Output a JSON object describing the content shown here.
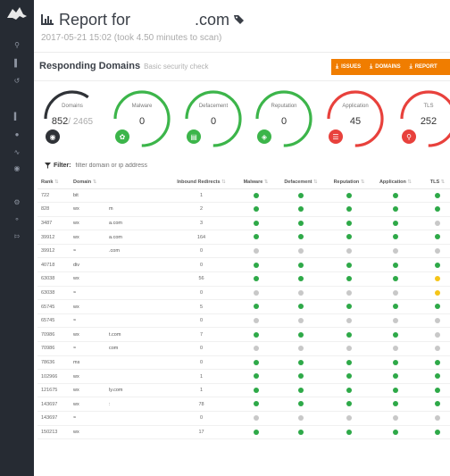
{
  "header": {
    "title_prefix": "Report for",
    "title_domain": ".com",
    "scan_info": "2017-05-21 15:02 (took 4.50 minutes to scan)"
  },
  "section": {
    "title": "Responding Domains",
    "subtitle": "Basic security check"
  },
  "buttons": {
    "issues": "ISSUES",
    "domains": "DOMAINS",
    "report": "REPORT"
  },
  "gauges": [
    {
      "label": "Domains",
      "value": "852",
      "total": "/ 2465",
      "color": "#2f3237",
      "icon": "globe-icon",
      "fraction": 0.35
    },
    {
      "label": "Malware",
      "value": "0",
      "total": "",
      "color": "#3cb54a",
      "icon": "bug-icon",
      "fraction": 0.75
    },
    {
      "label": "Defacement",
      "value": "0",
      "total": "",
      "color": "#3cb54a",
      "icon": "file-icon",
      "fraction": 0.75
    },
    {
      "label": "Reputation",
      "value": "0",
      "total": "",
      "color": "#3cb54a",
      "icon": "tag-icon",
      "fraction": 0.75
    },
    {
      "label": "Application",
      "value": "45",
      "total": "",
      "color": "#e8413c",
      "icon": "database-icon",
      "fraction": 0.75
    },
    {
      "label": "TLS",
      "value": "252",
      "total": "",
      "color": "#e8413c",
      "icon": "key-icon",
      "fraction": 0.75
    }
  ],
  "filter": {
    "label": "Filter:",
    "placeholder": "filter domain or ip address"
  },
  "table": {
    "columns": [
      "Rank",
      "Domain",
      "Inbound Redirects",
      "Malware",
      "Defacement",
      "Reputation",
      "Application",
      "TLS"
    ],
    "rows": [
      {
        "rank": "722",
        "prefix": "bit",
        "domain_tail": "",
        "redirects": "1",
        "status": [
          "g",
          "g",
          "g",
          "g",
          "g"
        ]
      },
      {
        "rank": "828",
        "prefix": "wx",
        "domain_tail": "m",
        "redirects": "2",
        "status": [
          "g",
          "g",
          "g",
          "g",
          "g"
        ]
      },
      {
        "rank": "3487",
        "prefix": "wx",
        "domain_tail": "a.com",
        "redirects": "3",
        "status": [
          "g",
          "g",
          "g",
          "g",
          "s"
        ]
      },
      {
        "rank": "39912",
        "prefix": "wx",
        "domain_tail": "a.com",
        "redirects": "164",
        "status": [
          "g",
          "g",
          "g",
          "g",
          "g"
        ]
      },
      {
        "rank": "39912",
        "prefix": "≈",
        "domain_tail": ".com",
        "redirects": "0",
        "status": [
          "s",
          "s",
          "s",
          "s",
          "s"
        ]
      },
      {
        "rank": "40718",
        "prefix": "div",
        "domain_tail": "",
        "redirects": "0",
        "status": [
          "g",
          "g",
          "g",
          "g",
          "g"
        ]
      },
      {
        "rank": "63038",
        "prefix": "wx",
        "domain_tail": "",
        "redirects": "56",
        "status": [
          "g",
          "g",
          "g",
          "g",
          "y"
        ]
      },
      {
        "rank": "63038",
        "prefix": "≈",
        "domain_tail": "",
        "redirects": "0",
        "status": [
          "s",
          "s",
          "s",
          "s",
          "y"
        ]
      },
      {
        "rank": "65745",
        "prefix": "wx",
        "domain_tail": "",
        "redirects": "5",
        "status": [
          "g",
          "g",
          "g",
          "g",
          "g"
        ]
      },
      {
        "rank": "65745",
        "prefix": "≈",
        "domain_tail": "",
        "redirects": "0",
        "status": [
          "s",
          "s",
          "s",
          "s",
          "s"
        ]
      },
      {
        "rank": "70986",
        "prefix": "wx",
        "domain_tail": "t.com",
        "redirects": "7",
        "status": [
          "g",
          "g",
          "g",
          "g",
          "s"
        ]
      },
      {
        "rank": "70986",
        "prefix": "≈",
        "domain_tail": "com",
        "redirects": "0",
        "status": [
          "s",
          "s",
          "s",
          "s",
          "s"
        ]
      },
      {
        "rank": "78636",
        "prefix": "ms",
        "domain_tail": "",
        "redirects": "0",
        "status": [
          "g",
          "g",
          "g",
          "g",
          "g"
        ]
      },
      {
        "rank": "102966",
        "prefix": "wx",
        "domain_tail": "",
        "redirects": "1",
        "status": [
          "g",
          "g",
          "g",
          "g",
          "g"
        ]
      },
      {
        "rank": "121675",
        "prefix": "wx",
        "domain_tail": "ly.com",
        "redirects": "1",
        "status": [
          "g",
          "g",
          "g",
          "g",
          "g"
        ]
      },
      {
        "rank": "143697",
        "prefix": "wx",
        "domain_tail": ":",
        "redirects": "78",
        "status": [
          "g",
          "g",
          "g",
          "g",
          "g"
        ]
      },
      {
        "rank": "143697",
        "prefix": "≈",
        "domain_tail": "",
        "redirects": "0",
        "status": [
          "s",
          "s",
          "s",
          "s",
          "s"
        ]
      },
      {
        "rank": "150213",
        "prefix": "wx",
        "domain_tail": "",
        "redirects": "17",
        "status": [
          "g",
          "g",
          "g",
          "g",
          "g"
        ]
      }
    ]
  }
}
